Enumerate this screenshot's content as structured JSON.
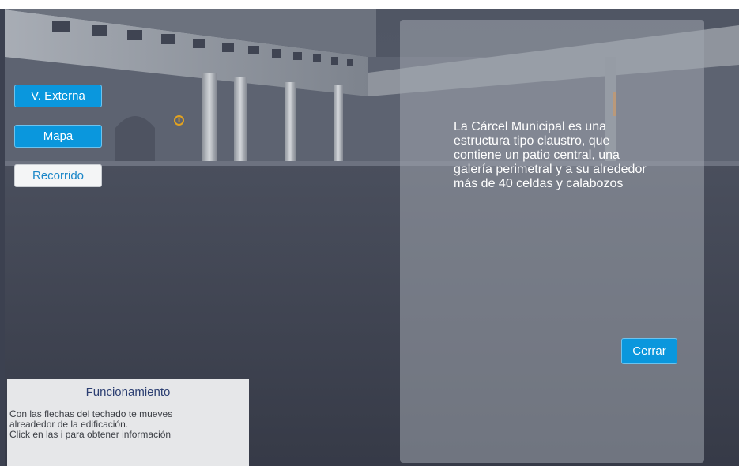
{
  "nav": {
    "external_view_label": "V. Externa",
    "map_label": "Mapa",
    "tour_label": "Recorrido"
  },
  "scene": {
    "info_marker_glyph": "i",
    "info_marker_color": "#e2a21f"
  },
  "info_panel": {
    "text": "La Cárcel Municipal es una estructura tipo claustro, que contiene un patio central, una galería perimetral y a su alrededor más de 40 celdas y calabozos",
    "close_label": "Cerrar"
  },
  "help": {
    "title": "Funcionamiento",
    "lines": [
      "Con las flechas del techado te mueves",
      "alreadedor de la edificación.",
      "Click en las i para obtener información"
    ]
  },
  "colors": {
    "button_blue": "#0a97dd",
    "button_white": "#f4f5f6",
    "help_title": "#2c3f72"
  }
}
